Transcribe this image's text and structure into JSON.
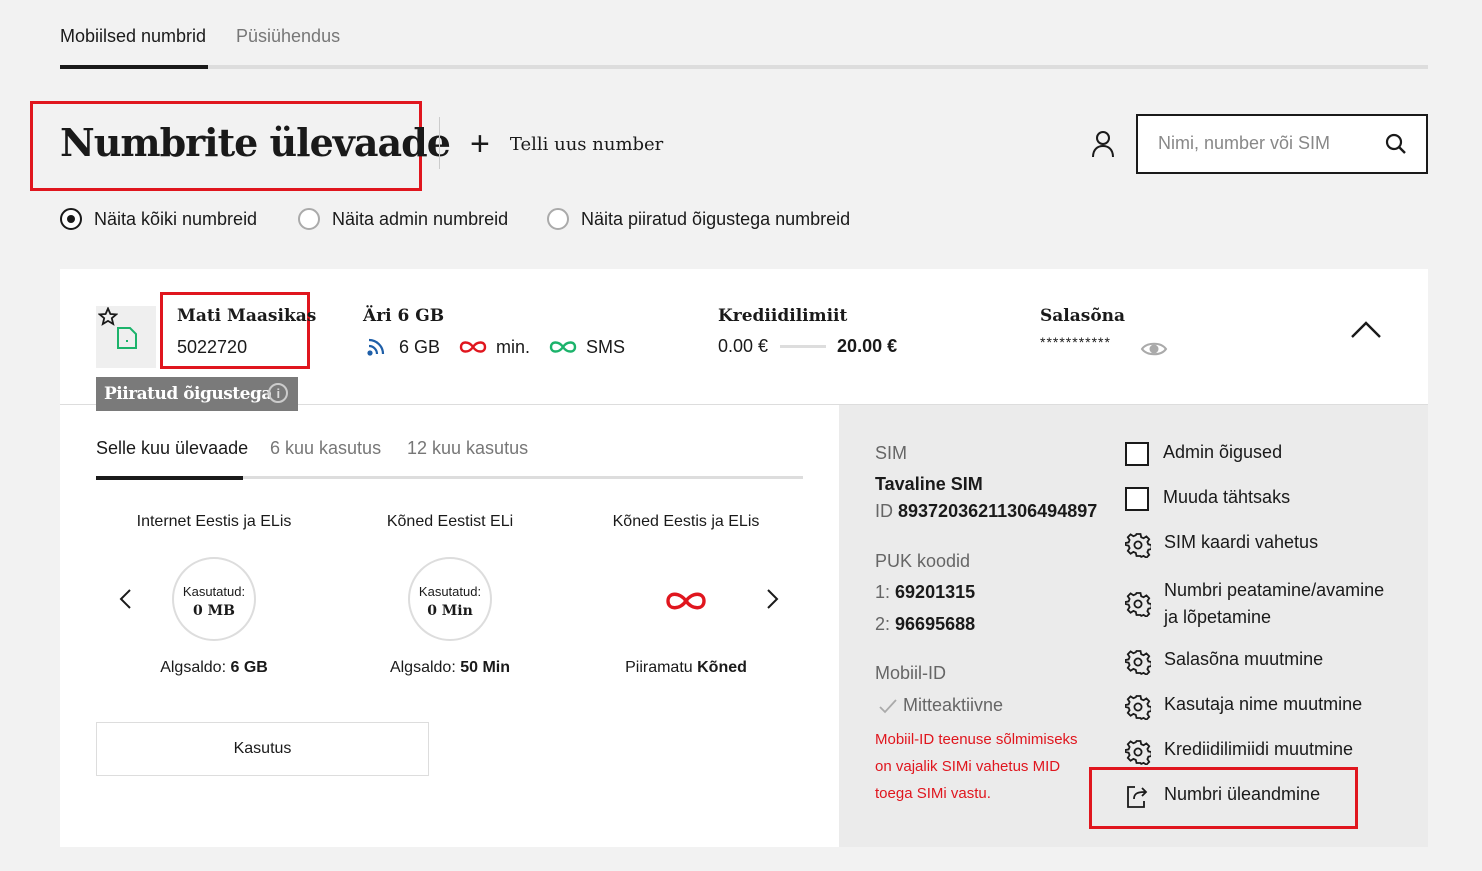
{
  "top_tabs": [
    {
      "label": "Mobiilsed numbrid",
      "active": true
    },
    {
      "label": "Püsiühendus",
      "active": false
    }
  ],
  "page_title": "Numbrite ülevaade",
  "order_new_number": "Telli uus number",
  "search": {
    "placeholder": "Nimi, number või SIM"
  },
  "filters": [
    {
      "label": "Näita kõiki numbreid",
      "checked": true
    },
    {
      "label": "Näita admin numbreid",
      "checked": false
    },
    {
      "label": "Näita piiratud õigustega numbreid",
      "checked": false
    }
  ],
  "subscriber": {
    "name": "Mati Maasikas",
    "number": "5022720",
    "badge": "Piiratud õigustega",
    "badge_info": "i"
  },
  "plan": {
    "name": "Äri 6 GB",
    "data": "6 GB",
    "minutes": "min.",
    "sms": "SMS"
  },
  "credit": {
    "heading": "Krediidilimiit",
    "used": "0.00 €",
    "limit": "20.00 €"
  },
  "password": {
    "heading": "Salasõna",
    "masked": "***********"
  },
  "inner_tabs": [
    {
      "label": "Selle kuu ülevaade",
      "active": true
    },
    {
      "label": "6 kuu kasutus",
      "active": false
    },
    {
      "label": "12 kuu kasutus",
      "active": false
    }
  ],
  "usage": [
    {
      "title": "Internet Eestis ja ELis",
      "used_label": "Kasutatud:",
      "used_value": "0 MB",
      "foot_label": "Algsaldo:",
      "foot_value": "6 GB"
    },
    {
      "title": "Kõned Eestist ELi",
      "used_label": "Kasutatud:",
      "used_value": "0 Min",
      "foot_label": "Algsaldo:",
      "foot_value": "50 Min"
    },
    {
      "title": "Kõned Eestis ja ELis",
      "foot_label": "Piiramatu",
      "foot_value": "Kõned"
    }
  ],
  "usage_button": "Kasutus",
  "sim": {
    "label": "SIM",
    "type": "Tavaline SIM",
    "id_label": "ID",
    "id_value": "89372036211306494897"
  },
  "puk": {
    "label": "PUK koodid",
    "code1_label": "1:",
    "code1": "69201315",
    "code2_label": "2:",
    "code2": "96695688"
  },
  "mobile_id": {
    "label": "Mobiil-ID",
    "status": "Mitteaktiivne",
    "note": "Mobiil-ID teenuse sõlmimiseks on vajalik SIMi vahetus MID toega SIMi vastu."
  },
  "actions": [
    {
      "label": "Admin õigused",
      "icon": "checkbox"
    },
    {
      "label": "Muuda tähtsaks",
      "icon": "checkbox"
    },
    {
      "label": "SIM kaardi vahetus",
      "icon": "gear-icon"
    },
    {
      "label": "Numbri peatamine/avamine ja lõpetamine",
      "icon": "gear-icon"
    },
    {
      "label": "Salasõna muutmine",
      "icon": "gear-icon"
    },
    {
      "label": "Kasutaja nime muutmine",
      "icon": "gear-icon"
    },
    {
      "label": "Krediidilimiidi muutmine",
      "icon": "gear-icon"
    },
    {
      "label": "Numbri üleandmine",
      "icon": "transfer-icon"
    }
  ],
  "colors": {
    "accent_red": "#e0161e",
    "green": "#1cb36b",
    "blue": "#1f5fa8",
    "dark": "#1a1a1a"
  }
}
